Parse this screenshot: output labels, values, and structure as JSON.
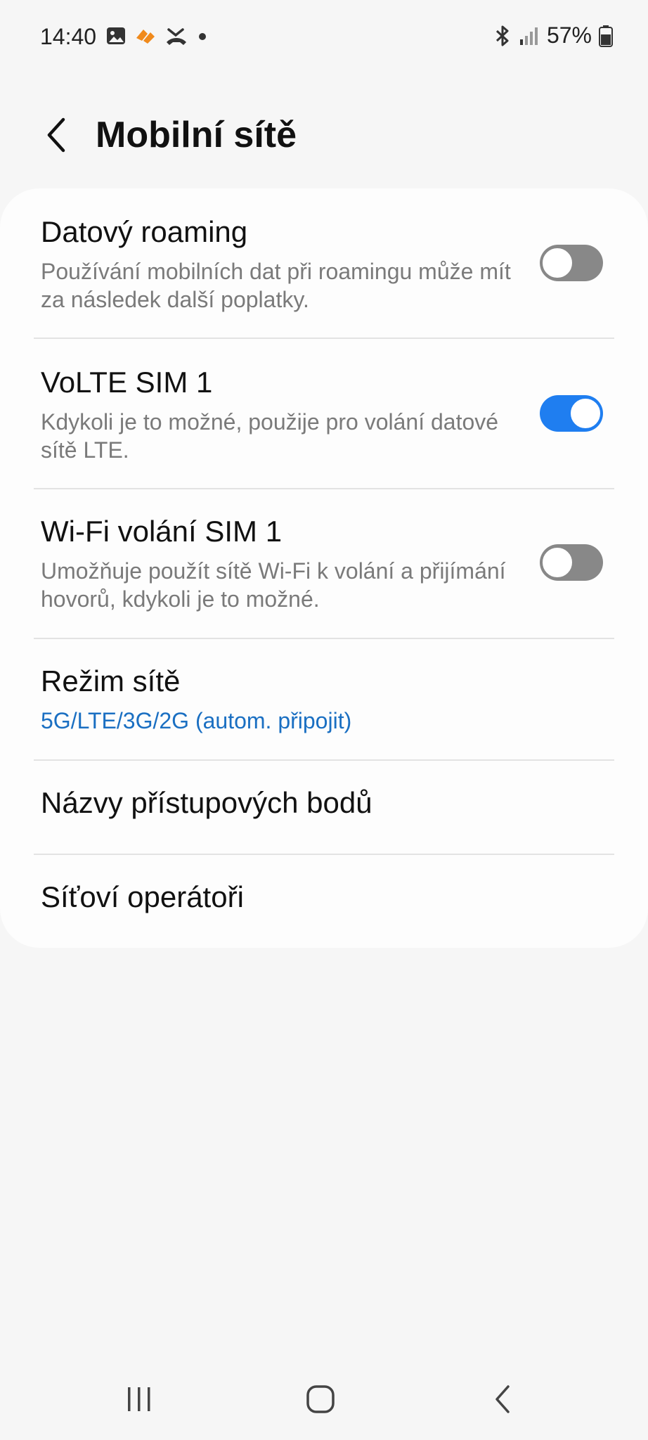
{
  "status_bar": {
    "time": "14:40",
    "battery_percent": "57%",
    "left_icons": [
      "gallery-icon",
      "app-notification-icon",
      "missed-call-icon",
      "dot-icon"
    ],
    "right_icons": [
      "bluetooth-icon",
      "signal-icon",
      "battery-icon"
    ]
  },
  "header": {
    "title": "Mobilní sítě",
    "back_icon": "chevron-left-icon"
  },
  "settings": {
    "items": [
      {
        "title": "Datový roaming",
        "subtitle": "Používání mobilních dat při roamingu může mít za následek další poplatky.",
        "toggle": false
      },
      {
        "title": "VoLTE SIM 1",
        "subtitle": "Kdykoli je to možné, použije pro volání datové sítě LTE.",
        "toggle": true
      },
      {
        "title": "Wi-Fi volání SIM 1",
        "subtitle": "Umožňuje použít sítě Wi-Fi k volání a přijímání hovorů, kdykoli je to možné.",
        "toggle": false
      },
      {
        "title": "Režim sítě",
        "subtitle": "5G/LTE/3G/2G (autom. připojit)"
      },
      {
        "title": "Názvy přístupových bodů"
      },
      {
        "title": "Síťoví operátoři"
      }
    ]
  },
  "colors": {
    "accent": "#1f7ef0",
    "link_text": "#1a6fc2",
    "toggle_off": "#888888",
    "background": "#f6f6f6",
    "card": "#fdfdfd"
  },
  "nav_bar": {
    "icons": [
      "recent-apps-icon",
      "home-icon",
      "back-icon"
    ]
  }
}
